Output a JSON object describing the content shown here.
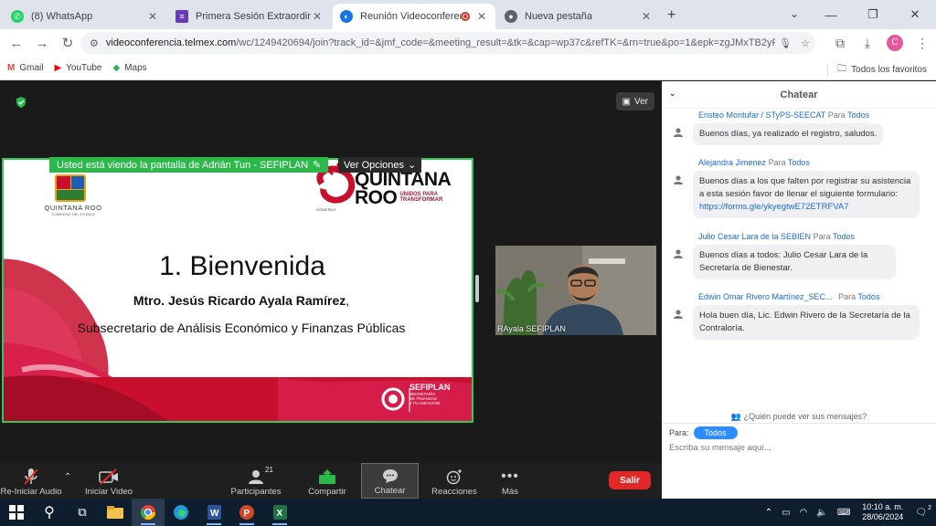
{
  "browser": {
    "tabs": [
      {
        "title": "(8) WhatsApp",
        "active": false,
        "favicon": "whatsapp-icon",
        "color": "#25d366"
      },
      {
        "title": "Primera Sesión Extraordinaria C",
        "active": false,
        "favicon": "forms-icon",
        "color": "#673ab7"
      },
      {
        "title": "Reunión Videoconferencia T",
        "active": true,
        "favicon": "telmex-icon",
        "color": "#1a73e8"
      },
      {
        "title": "Nueva pestaña",
        "active": false,
        "favicon": "chrome-icon",
        "color": "#5f6368"
      }
    ],
    "new_tab": "+",
    "url_host": "videoconferencia.telmex.com",
    "url_path": "/wc/1249420694/join?track_id=&jmf_code=&meeting_result=&tk=&cap=wp37c&refTK=&rn=true&po=1&epk=zgJMxTB2yR...",
    "profile_initial": "C",
    "bookmarks": [
      {
        "label": "Gmail",
        "icon": "gmail-icon"
      },
      {
        "label": "YouTube",
        "icon": "youtube-icon"
      },
      {
        "label": "Maps",
        "icon": "maps-icon"
      }
    ],
    "all_bookmarks": "Todos los favoritos"
  },
  "meeting": {
    "view_label": "Ver",
    "share_banner": "Usted está viendo la pantalla de Adrián Tun - SEFIPLAN",
    "view_options": "Ver Opciones",
    "slide": {
      "title": "1. Bienvenida",
      "name": "Mtro. Jesús Ricardo Ayala Ramírez",
      "name_suffix": ",",
      "role": "Subsecretario de Análisis Económico y Finanzas Públicas",
      "logo_left_text": "QUINTANA ROO",
      "logo_left_sub": "GOBIERNO DEL ESTADO",
      "logo_right_big1": "QUINTANA",
      "logo_right_big2": "ROO",
      "logo_right_sub1": "UNIDOS PARA",
      "logo_right_sub2": "TRANSFORMAR",
      "logo_right_small": "GOBIERNO",
      "footer_name": "SEFIPLAN",
      "footer_desc1": "SECRETARÍA",
      "footer_desc2": "DE FINANZAS",
      "footer_desc3": "Y PLANEACIÓN"
    },
    "video_name": "RAyala SEFIPLAN"
  },
  "controls": {
    "audio": "Re-Iniciar Audio",
    "video": "Iniciar Video",
    "participants": "Participantes",
    "participants_count": "21",
    "share": "Compartir",
    "chat": "Chatear",
    "reactions": "Reacciones",
    "more": "Más",
    "leave": "Salir"
  },
  "chat": {
    "title": "Chatear",
    "to_word": "Para",
    "messages": [
      {
        "from": "Eristeo Montufar / STyPS-SEECAT",
        "to": "Todos",
        "text": "Buenos días, ya realizado el registro, saludos."
      },
      {
        "from": "Alejandra Jimenez",
        "to": "Todos",
        "text": "Buenos días a los que falten por registrar su asistencia a esta sesión favor de llenar el siguiente formulario: ",
        "link": "https://forms.gle/ykyegtwE72ETRFVA7"
      },
      {
        "from": "Julio Cesar Lara de la SEBIEN",
        "to": "Todos",
        "text": "Buenos días a todos: Julio Cesar Lara de la Secretaría de Bienestar."
      },
      {
        "from": "Edwin Omar Rivero Martínez_SEC...",
        "to": "Todos",
        "text": "Hola buen día, Lic. Edwin Rivero de la Secretaría de la Contraloría."
      }
    ],
    "who_can_see": "¿Quién puede ver sus mensajes?",
    "to_label": "Para:",
    "to_value": "Todos",
    "compose_placeholder": "Escriba su mensaje aquí..."
  },
  "taskbar": {
    "time": "10:10 a. m.",
    "date": "28/06/2024",
    "notifications": "2"
  }
}
